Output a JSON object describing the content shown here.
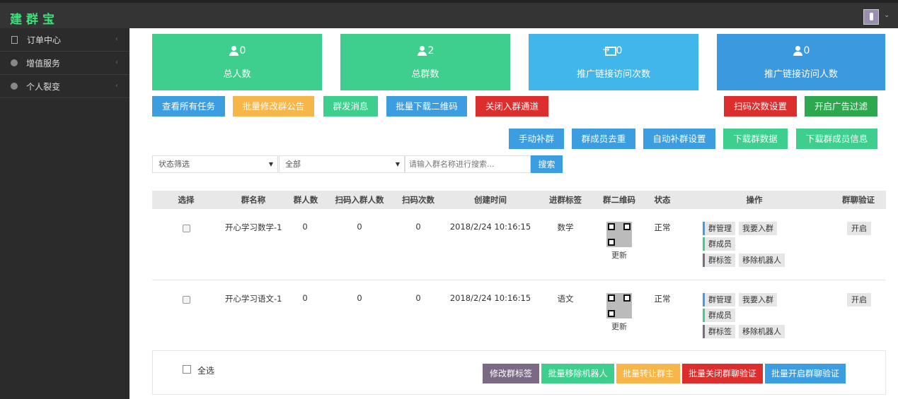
{
  "app": {
    "logo": "建群宝"
  },
  "sidebar": {
    "items": [
      {
        "label": "订单中心",
        "icon": "document-icon"
      },
      {
        "label": "增值服务",
        "icon": "circle-icon"
      },
      {
        "label": "个人裂变",
        "icon": "circle-icon"
      }
    ]
  },
  "stats": [
    {
      "value": "0",
      "label": "总人数",
      "icon": "user-icon"
    },
    {
      "value": "2",
      "label": "总群数",
      "icon": "users-icon"
    },
    {
      "value": "0",
      "label": "推广链接访问次数",
      "icon": "enter-icon"
    },
    {
      "value": "0",
      "label": "推广链接访问人数",
      "icon": "user-add-icon"
    }
  ],
  "toolbar": {
    "view_all_tasks": "查看所有任务",
    "batch_edit_notice": "批量修改群公告",
    "mass_message": "群发消息",
    "batch_download_qr": "批量下载二维码",
    "close_join": "关闭入群通道",
    "scan_settings": "扫码次数设置",
    "ad_filter": "开启广告过滤",
    "manual_fill": "手动补群",
    "dedupe_members": "群成员去重",
    "auto_fill_settings": "自动补群设置",
    "download_group_data": "下载群数据",
    "download_member_info": "下载群成员信息"
  },
  "filters": {
    "status": "状态筛选",
    "scope": "全部",
    "search_placeholder": "请输入群名称进行搜索...",
    "search_button": "搜索"
  },
  "table": {
    "columns": [
      "选择",
      "群名称",
      "群人数",
      "扫码入群人数",
      "扫码次数",
      "创建时间",
      "进群标签",
      "群二维码",
      "状态",
      "操作",
      "群聊验证"
    ],
    "rows": [
      {
        "name": "开心学习数学-1",
        "members": "0",
        "scan_joined": "0",
        "scans": "0",
        "created": "2018/2/24 10:16:15",
        "tag": "数学",
        "qr_update": "更新",
        "status": "正常",
        "verify": "开启"
      },
      {
        "name": "开心学习语文-1",
        "members": "0",
        "scan_joined": "0",
        "scans": "0",
        "created": "2018/2/24 10:16:15",
        "tag": "语文",
        "qr_update": "更新",
        "status": "正常",
        "verify": "开启"
      }
    ],
    "actions": {
      "manage": "群管理",
      "join": "我要入群",
      "members": "群成员",
      "tags": "群标签",
      "remove_robot": "移除机器人"
    }
  },
  "footer": {
    "select_all": "全选",
    "edit_tags": "修改群标签",
    "batch_remove_robot": "批量移除机器人",
    "batch_transfer_owner": "批量转让群主",
    "batch_close_verify": "批量关闭群聊验证",
    "batch_open_verify": "批量开启群聊验证"
  }
}
